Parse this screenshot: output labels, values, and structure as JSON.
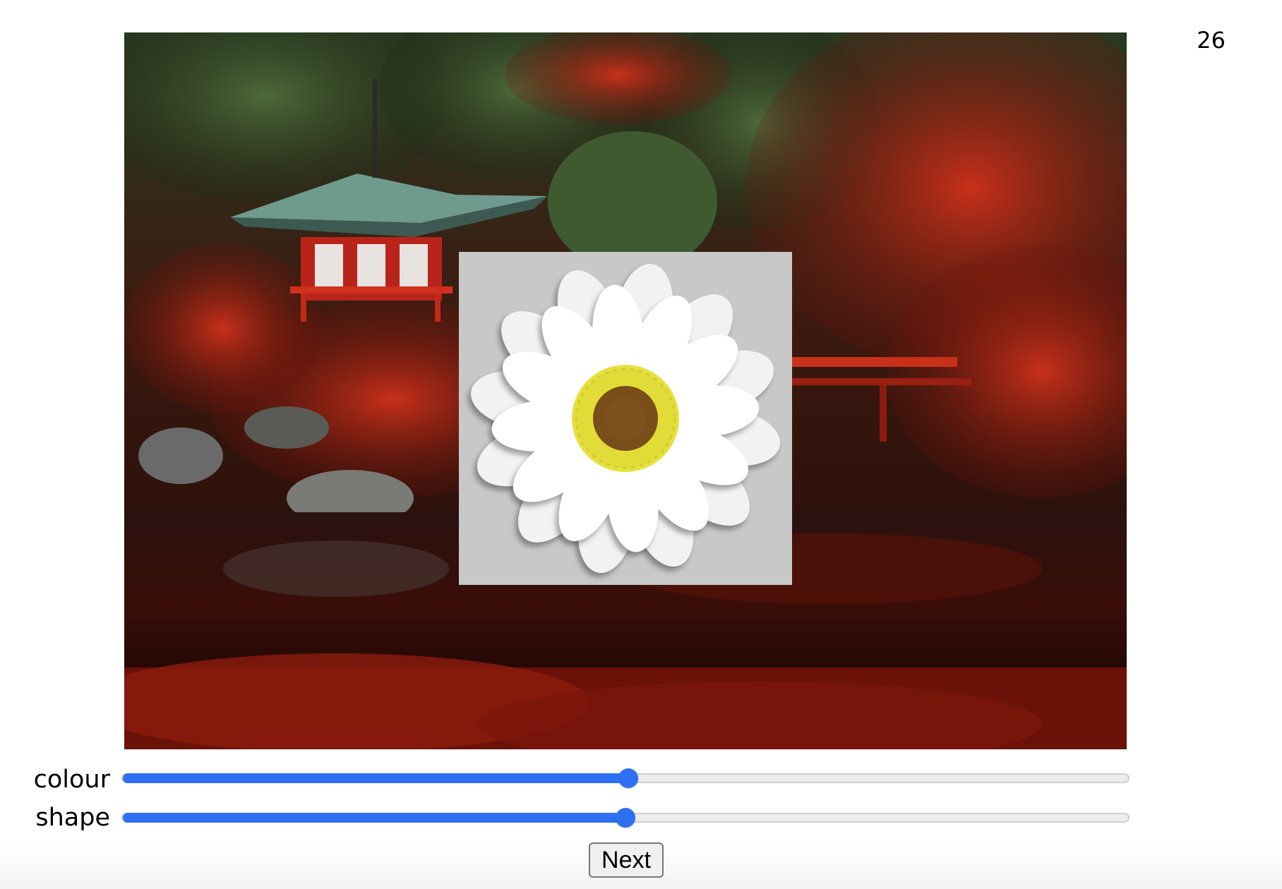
{
  "trial_counter": "26",
  "scene": {
    "description_icon": "garden-pagoda-photo",
    "stimulus_icon": "daisy-flower-icon"
  },
  "sliders": [
    {
      "label": "colour",
      "value_percent": 50
    },
    {
      "label": "shape",
      "value_percent": 50
    }
  ],
  "next_button": {
    "label": "Next"
  },
  "colors": {
    "accent": "#2f6ff2",
    "stimulus_bg": "#c8c8c8",
    "petal": "#ffffff",
    "disc_ring": "#e6e040",
    "disc_center": "#7a4e1a"
  }
}
